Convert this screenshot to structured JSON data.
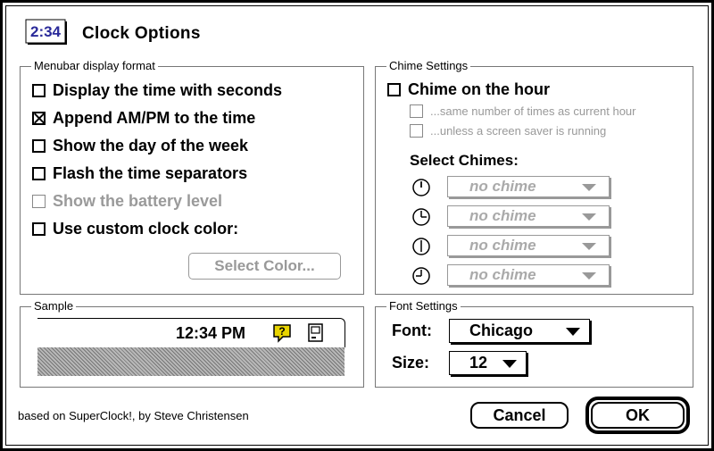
{
  "dialog": {
    "title": "Clock Options",
    "icon_text": "2:34",
    "credit": "based on SuperClock!, by Steve Christensen"
  },
  "menubar_format": {
    "label": "Menubar display format",
    "options": [
      {
        "label": "Display the time with seconds",
        "checked": false,
        "enabled": true
      },
      {
        "label": "Append AM/PM to the time",
        "checked": true,
        "enabled": true
      },
      {
        "label": "Show the day of the week",
        "checked": false,
        "enabled": true
      },
      {
        "label": "Flash the time separators",
        "checked": false,
        "enabled": true
      },
      {
        "label": "Show the battery level",
        "checked": false,
        "enabled": false
      },
      {
        "label": "Use custom clock color:",
        "checked": false,
        "enabled": true
      }
    ],
    "select_color_label": "Select Color..."
  },
  "chime_settings": {
    "label": "Chime Settings",
    "chime_on_hour": "Chime on the hour",
    "same_number": "...same number of times as current hour",
    "unless_saver": "...unless a screen saver is running",
    "select_chimes": "Select Chimes:",
    "chimes": [
      {
        "icon": "clock-12-icon",
        "value": "no chime"
      },
      {
        "icon": "clock-3-icon",
        "value": "no chime"
      },
      {
        "icon": "clock-6-icon",
        "value": "no chime"
      },
      {
        "icon": "clock-9-icon",
        "value": "no chime"
      }
    ]
  },
  "sample": {
    "label": "Sample",
    "time": "12:34 PM"
  },
  "font_settings": {
    "label": "Font Settings",
    "font_label": "Font:",
    "font_value": "Chicago",
    "size_label": "Size:",
    "size_value": "12"
  },
  "buttons": {
    "cancel": "Cancel",
    "ok": "OK"
  }
}
